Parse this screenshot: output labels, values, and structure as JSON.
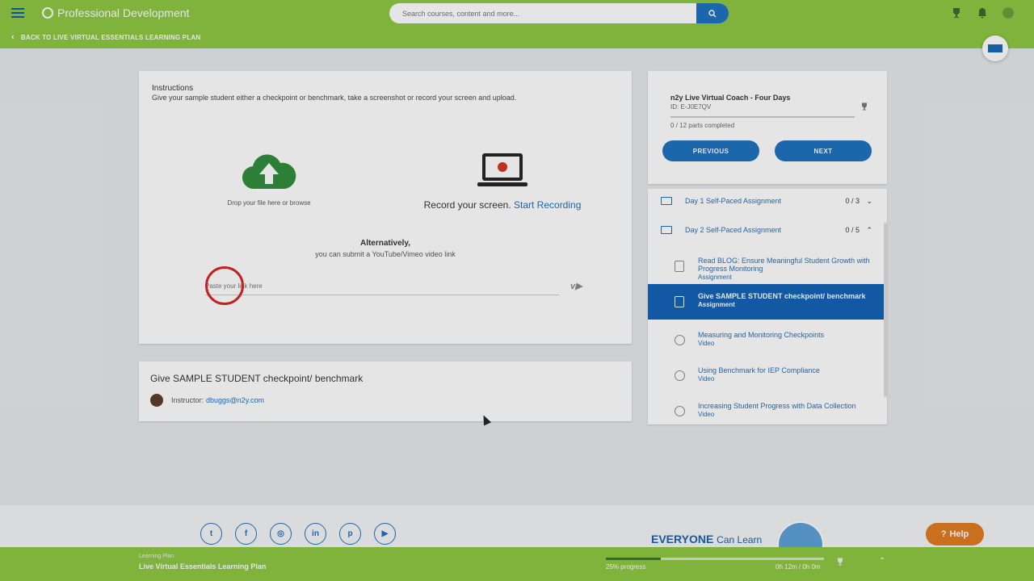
{
  "header": {
    "brand": "Professional Development",
    "search_placeholder": "Search courses, content and more...",
    "back_link": "BACK TO LIVE VIRTUAL ESSENTIALS LEARNING PLAN",
    "accent_color": "#8cc63f"
  },
  "instructions": {
    "title": "Instructions",
    "description": "Give your sample student either a checkpoint or benchmark, take a screenshot or record your screen and upload.",
    "upload_text": "Drop your file here or browse",
    "record_text": "Record your screen.",
    "record_link": "Start Recording",
    "alt_title": "Alternatively,",
    "alt_sub": "you can submit a YouTube/Vimeo video link",
    "link_placeholder": "Paste your link here"
  },
  "assignment": {
    "title": "Give SAMPLE STUDENT checkpoint/ benchmark",
    "instructor_label": "Instructor:",
    "instructor_email": "dbuggs@n2y.com"
  },
  "course": {
    "title": "n2y Live Virtual Coach - Four Days",
    "id": "ID: E-J0E7QV",
    "parts": "0 / 12 parts completed",
    "previous": "PREVIOUS",
    "next": "NEXT"
  },
  "sections": [
    {
      "label": "Day 1 Self-Paced Assignment",
      "count": "0 / 3"
    },
    {
      "label": "Day 2 Self-Paced Assignment",
      "count": "0 / 5"
    }
  ],
  "items": [
    {
      "name": "Read BLOG: Ensure Meaningful Student Growth with Progress Monitoring",
      "type": "Assignment"
    },
    {
      "name": "Give SAMPLE STUDENT checkpoint/ benchmark",
      "type": "Assignment"
    },
    {
      "name": "Measuring and Monitoring Checkpoints",
      "type": "Video"
    },
    {
      "name": "Using Benchmark for IEP Compliance",
      "type": "Video"
    },
    {
      "name": "Increasing Student Progress with Data Collection",
      "type": "Video"
    }
  ],
  "footer": {
    "tagline_bold": "EVERYONE",
    "tagline_rest": "Can Learn",
    "help": "Help"
  },
  "bottombar": {
    "learning_plan_label": "Learning Plan",
    "learning_plan_name": "Live Virtual Essentials Learning Plan",
    "progress_text": "25% progress",
    "progress_fraction": 0.25,
    "time": "0h 12m / 0h 0m"
  }
}
